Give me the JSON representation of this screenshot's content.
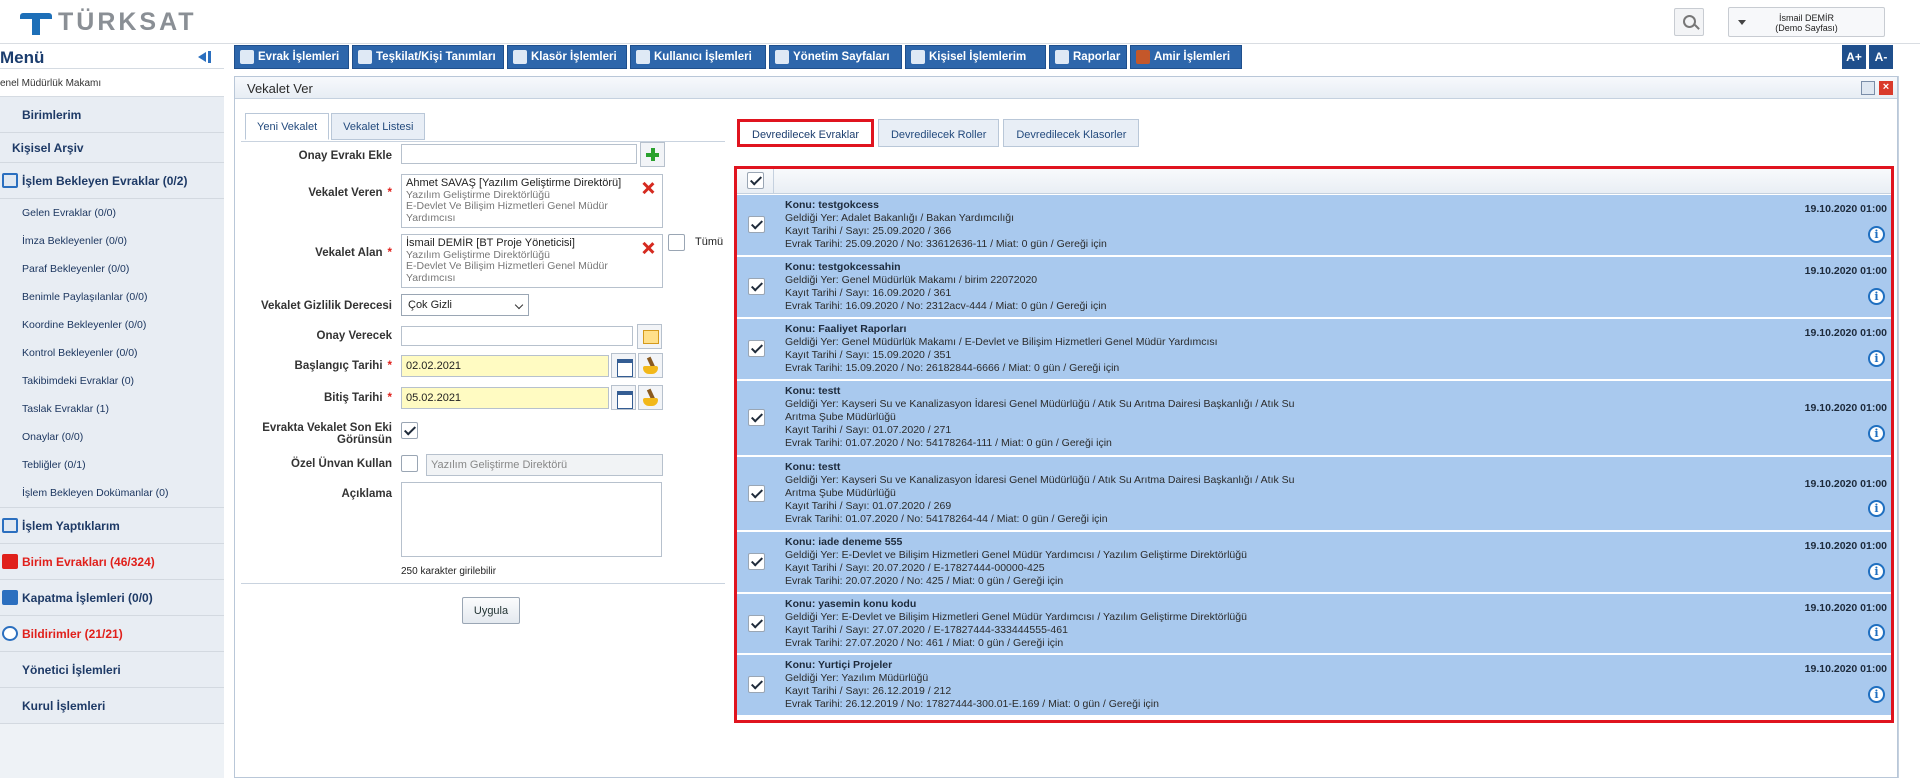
{
  "brand": {
    "name": "TÜRKSAT"
  },
  "user": {
    "name": "İsmail DEMİR",
    "sub": "(Demo Sayfası)"
  },
  "sidebar": {
    "title": "Menü",
    "crumb": "enel Müdürlük Makamı",
    "sections": [
      {
        "label": "Birimlerim"
      },
      {
        "label": "Kişisel Arşiv"
      },
      {
        "label": "İşlem Bekleyen Evraklar (0/2)"
      },
      {
        "label": "İşlem Yaptıklarım"
      },
      {
        "label": "Birim Evrakları (46/324)",
        "red": true
      },
      {
        "label": "Kapatma İşlemleri (0/0)"
      },
      {
        "label": "Bildirimler (21/21)",
        "red": true
      },
      {
        "label": "Yönetici İşlemleri"
      },
      {
        "label": "Kurul İşlemleri"
      }
    ],
    "sub_items": [
      "Gelen Evraklar (0/0)",
      "İmza Bekleyenler (0/0)",
      "Paraf Bekleyenler (0/0)",
      "Benimle Paylaşılanlar (0/0)",
      "Koordine Bekleyenler (0/0)",
      "Kontrol Bekleyenler (0/0)",
      "Takibimdeki Evraklar (0)",
      "Taslak Evraklar (1)",
      "Onaylar (0/0)",
      "Tebliğler (0/1)",
      "İşlem Bekleyen Dokümanlar (0)"
    ]
  },
  "nav": [
    "Evrak İşlemleri",
    "Teşkilat/Kişi Tanımları",
    "Klasör İşlemleri",
    "Kullanıcı İşlemleri",
    "Yönetim Sayfaları",
    "Kişisel İşlemlerim",
    "Raporlar",
    "Amir İşlemleri"
  ],
  "font_buttons": [
    "A+",
    "A-"
  ],
  "panel": {
    "title": "Vekalet Ver",
    "tabs": [
      "Yeni Vekalet",
      "Vekalet Listesi"
    ]
  },
  "form": {
    "onay_evraki_label": "Onay Evrakı Ekle",
    "veren_label": "Vekalet Veren",
    "veren": {
      "main": "Ahmet SAVAŞ [Yazılım Geliştirme Direktörü]",
      "l1": "Yazılım Geliştirme Direktörlüğü",
      "l2": "E-Devlet Ve Bilişim Hizmetleri Genel Müdür",
      "l3": "Yardımcısı"
    },
    "alan_label": "Vekalet Alan",
    "alan": {
      "main": "İsmail DEMİR [BT Proje Yöneticisi]",
      "l1": "Yazılım Geliştirme Direktörlüğü",
      "l2": "E-Devlet Ve Bilişim Hizmetleri Genel Müdür",
      "l3": "Yardımcısı"
    },
    "tumu": "Tümü",
    "gizlilik_label": "Vekalet Gizlilik Derecesi",
    "gizlilik_value": "Çok Gizli",
    "onay_verecek_label": "Onay Verecek",
    "baslangic_label": "Başlangıç Tarihi",
    "baslangic_value": "02.02.2021",
    "bitis_label": "Bitiş Tarihi",
    "bitis_value": "05.02.2021",
    "son_ek_label_1": "Evrakta Vekalet Son Eki",
    "son_ek_label_2": "Görünsün",
    "ozel_unvan_label": "Özel Ünvan Kullan",
    "ozel_unvan_value": "Yazılım Geliştirme Direktörü",
    "aciklama_label": "Açıklama",
    "char_hint": "250 karakter girilebilir",
    "apply": "Uygula"
  },
  "right_tabs": [
    "Devredilecek Evraklar",
    "Devredilecek Roller",
    "Devredilecek Klasorler"
  ],
  "docs": [
    {
      "konu": "Konu: testgokcess",
      "l1": "Geldiği Yer: Adalet Bakanlığı / Bakan Yardımcılığı",
      "l2": "",
      "l3": "Kayıt Tarihi / Sayı: 25.09.2020 / 366",
      "l4": "Evrak Tarihi: 25.09.2020 / No: 33612636-11 / Miat: 0 gün / Gereği için",
      "date": "19.10.2020 01:00"
    },
    {
      "konu": "Konu: testgokcessahin",
      "l1": "Geldiği Yer: Genel Müdürlük Makamı / birim 22072020",
      "l2": "",
      "l3": "Kayıt Tarihi / Sayı: 16.09.2020 / 361",
      "l4": "Evrak Tarihi: 16.09.2020 / No: 2312acv-444 / Miat: 0 gün / Gereği için",
      "date": "19.10.2020 01:00"
    },
    {
      "konu": "Konu: Faaliyet Raporları",
      "l1": "Geldiği Yer: Genel Müdürlük Makamı / E-Devlet ve Bilişim Hizmetleri Genel Müdür Yardımcısı",
      "l2": "",
      "l3": "Kayıt Tarihi / Sayı: 15.09.2020 / 351",
      "l4": "Evrak Tarihi: 15.09.2020 / No: 26182844-6666 / Miat: 0 gün / Gereği için",
      "date": "19.10.2020 01:00"
    },
    {
      "konu": "Konu: testt",
      "l1": "Geldiği Yer: Kayseri Su ve Kanalizasyon İdaresi Genel Müdürlüğü / Atık Su Arıtma Dairesi Başkanlığı / Atık Su",
      "l2": "Arıtma Şube Müdürlüğü",
      "l3": "Kayıt Tarihi / Sayı: 01.07.2020 / 271",
      "l4": "Evrak Tarihi: 01.07.2020 / No: 54178264-111 / Miat: 0 gün / Gereği için",
      "date": "19.10.2020 01:00"
    },
    {
      "konu": "Konu: testt",
      "l1": "Geldiği Yer: Kayseri Su ve Kanalizasyon İdaresi Genel Müdürlüğü / Atık Su Arıtma Dairesi Başkanlığı / Atık Su",
      "l2": "Arıtma Şube Müdürlüğü",
      "l3": "Kayıt Tarihi / Sayı: 01.07.2020 / 269",
      "l4": "Evrak Tarihi: 01.07.2020 / No: 54178264-44 / Miat: 0 gün / Gereği için",
      "date": "19.10.2020 01:00"
    },
    {
      "konu": "Konu: iade deneme 555",
      "l1": "Geldiği Yer: E-Devlet ve Bilişim Hizmetleri Genel Müdür Yardımcısı / Yazılım Geliştirme Direktörlüğü",
      "l2": "",
      "l3": "Kayıt Tarihi / Sayı: 20.07.2020 / E-17827444-00000-425",
      "l4": "Evrak Tarihi: 20.07.2020 / No: 425 / Miat: 0 gün / Gereği için",
      "date": "19.10.2020 01:00"
    },
    {
      "konu": "Konu: yasemin konu kodu",
      "l1": "Geldiği Yer: E-Devlet ve Bilişim Hizmetleri Genel Müdür Yardımcısı / Yazılım Geliştirme Direktörlüğü",
      "l2": "",
      "l3": "Kayıt Tarihi / Sayı: 27.07.2020 / E-17827444-333444555-461",
      "l4": "Evrak Tarihi: 27.07.2020 / No: 461 / Miat: 0 gün / Gereği için",
      "date": "19.10.2020 01:00"
    },
    {
      "konu": "Konu: Yurtiçi Projeler",
      "l1": "Geldiği Yer: Yazılım Müdürlüğü",
      "l2": "",
      "l3": "Kayıt Tarihi / Sayı: 26.12.2019 / 212",
      "l4": "Evrak Tarihi: 26.12.2019 / No: 17827444-300.01-E.169 / Miat: 0 gün / Gereği için",
      "date": "19.10.2020 01:00"
    }
  ],
  "info_glyph": "i",
  "close_glyph": "×",
  "colors": {
    "nav": "#2d66ab",
    "row": "#a9c9ee",
    "highlight": "#e0141f",
    "required": "#e0201b"
  }
}
